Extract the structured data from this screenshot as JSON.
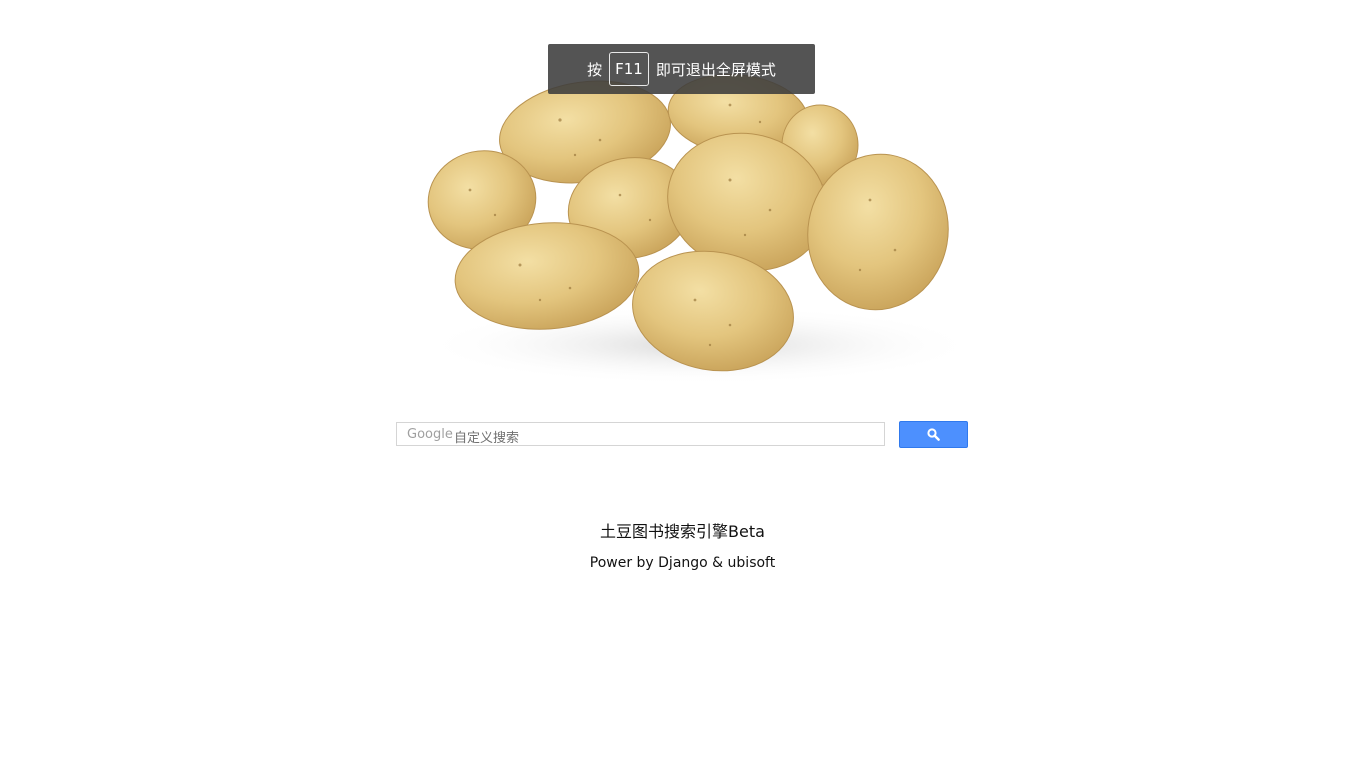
{
  "fullscreen_notice": {
    "prefix": "按",
    "key": "F11",
    "suffix": "即可退出全屏模式"
  },
  "hero": {
    "image_name": "potatoes"
  },
  "search": {
    "brand": "Google",
    "placeholder": "自定义搜索",
    "value": "",
    "button_icon": "search-icon",
    "button_color": "#4d90fe"
  },
  "footer": {
    "title": "土豆图书搜索引擎Beta",
    "credit": "Power by Django & ubisoft"
  }
}
